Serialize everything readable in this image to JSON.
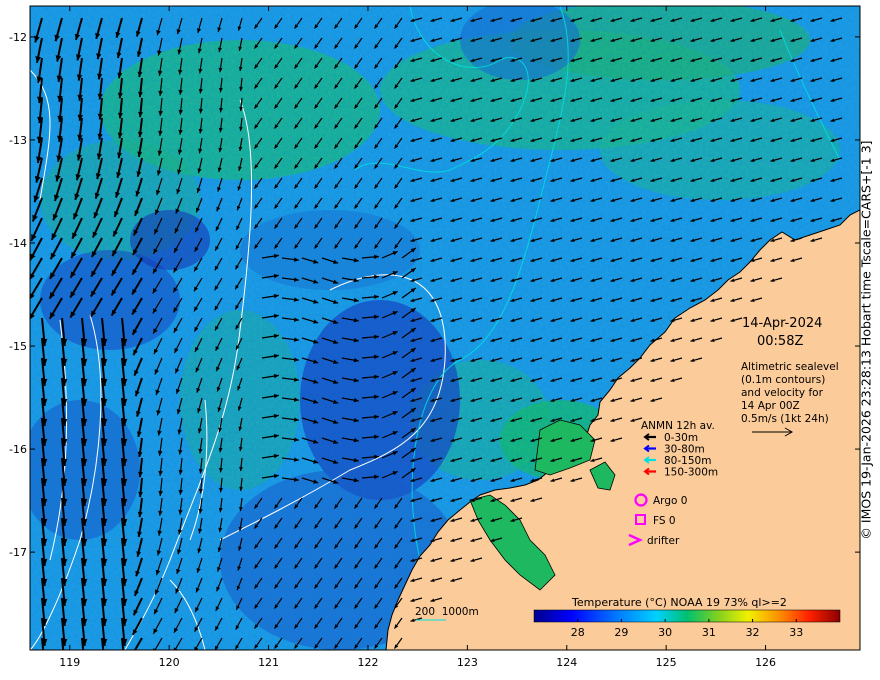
{
  "map": {
    "date": "14-Apr-2024",
    "time": "00:58Z",
    "altimetry_note": [
      "Altimetric sealevel",
      "(0.1m contours)",
      "and velocity for",
      "14 Apr 00Z",
      "0.5m/s (1kt 24h)"
    ],
    "legend": {
      "title": "ANMN 12h av.",
      "items": [
        {
          "label": "0-30m",
          "color": "#000000"
        },
        {
          "label": "30-80m",
          "color": "#0000ff"
        },
        {
          "label": "80-150m",
          "color": "#00e0e0"
        },
        {
          "label": "150-300m",
          "color": "#ff0000"
        }
      ],
      "argo": "Argo 0",
      "fs": "FS 0",
      "drifter": "drifter",
      "marker_color": "#ff00ff"
    },
    "bathymetry_label": "200  1000m",
    "colorbar": {
      "title": "Temperature (°C) NOAA 19 73% ql>=2",
      "ticks": [
        "28",
        "29",
        "30",
        "31",
        "32",
        "33"
      ],
      "range": [
        27.0,
        34.0
      ]
    },
    "x_ticks": [
      "119",
      "120",
      "121",
      "122",
      "123",
      "124",
      "125",
      "126"
    ],
    "y_ticks": [
      "-12",
      "-13",
      "-14",
      "-15",
      "-16",
      "-17"
    ],
    "lon_range": [
      118.6,
      126.95
    ],
    "lat_range": [
      -17.95,
      -11.7
    ],
    "copyright": "© IMOS 19-Jan-2026 23:28:13 Hobart time Tscale=CARS+[-1 3]",
    "colors": {
      "land": "#fbcb99",
      "coast": "#000000",
      "contour": "#ffffff",
      "isobath": "#00e0e0"
    }
  }
}
